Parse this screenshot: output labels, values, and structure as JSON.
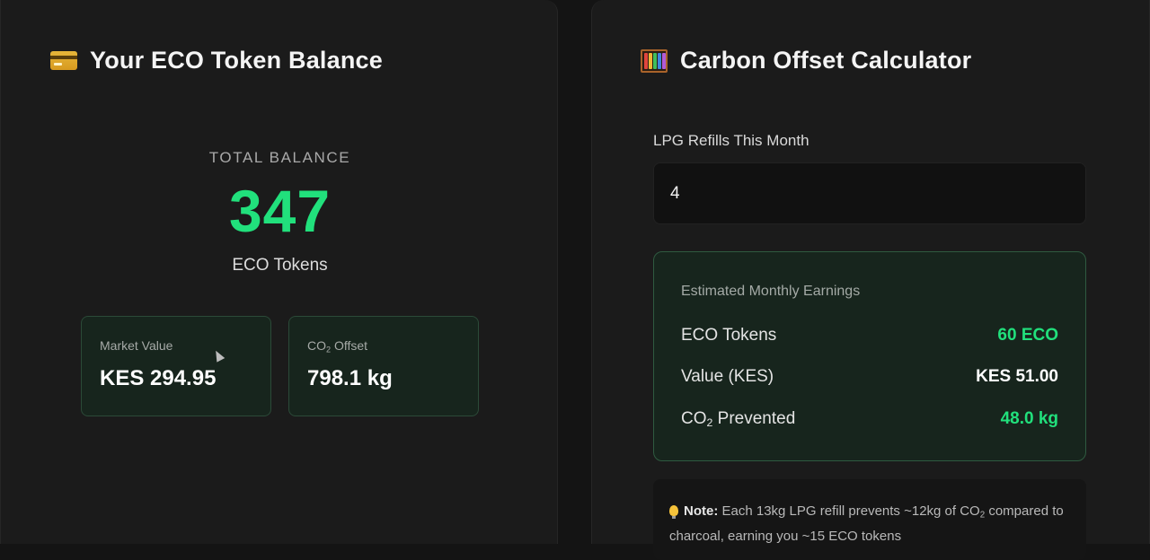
{
  "balance_card": {
    "title": "Your ECO Token Balance",
    "icon": "credit-card-icon",
    "total_label": "TOTAL BALANCE",
    "total_value": "347",
    "unit": "ECO Tokens",
    "market_value_label": "Market Value",
    "market_value": "KES 294.95",
    "co2_offset_label_prefix": "CO",
    "co2_offset_label_sub": "2",
    "co2_offset_label_suffix": " Offset",
    "co2_offset_value": "798.1 kg"
  },
  "calculator_card": {
    "title": "Carbon Offset Calculator",
    "icon": "abacus-icon",
    "refills_label": "LPG Refills This Month",
    "refills_value": "4",
    "earnings_title": "Estimated Monthly Earnings",
    "rows": [
      {
        "label": "ECO Tokens",
        "value": "60 ECO"
      },
      {
        "label": "Value (KES)",
        "value": "KES 51.00"
      },
      {
        "label_prefix": "CO",
        "label_sub": "2",
        "label_suffix": " Prevented",
        "value": "48.0 kg"
      }
    ],
    "note_bold": "Note:",
    "note_text_1": " Each 13kg LPG refill prevents ~12kg of CO",
    "note_sub": "2",
    "note_text_2": " compared to charcoal, earning you ~15 ECO tokens"
  },
  "colors": {
    "accent_green": "#21e07c",
    "background": "#141414",
    "panel": "#1b1b1b"
  }
}
